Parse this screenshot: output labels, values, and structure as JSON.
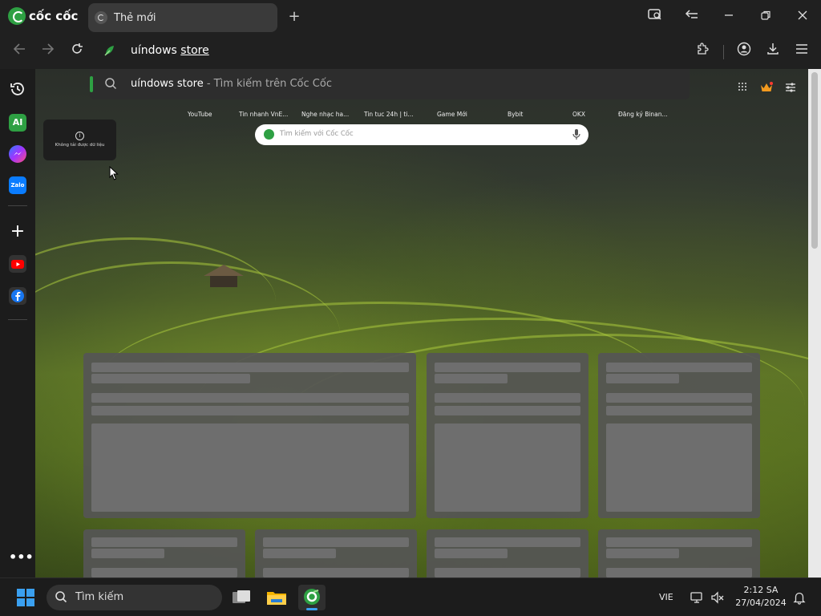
{
  "browser": {
    "brand": "cốc cốc",
    "tab_title": "Thẻ mới",
    "address_text_pre": "uíndows ",
    "address_text_underlined": "store"
  },
  "suggestion": {
    "query": "uíndows store",
    "suffix": " - Tìm kiếm trên Cốc Cốc"
  },
  "shortcuts": [
    "YouTube",
    "Tin nhanh VnE...",
    "Nghe nhạc ha...",
    "Tin tuc 24h | ti...",
    "Game Mới",
    "Bybit",
    "OKX",
    "Đăng ký Binan..."
  ],
  "search": {
    "placeholder": "Tìm kiếm với Cốc Cốc"
  },
  "tooltip": {
    "text": "Không tải được dữ liệu"
  },
  "sidebar": {
    "ai_label": "AI",
    "zalo_label": "Zalo"
  },
  "taskbar": {
    "search_label": "Tìm kiếm",
    "language": "VIE",
    "time": "2:12 SA",
    "date": "27/04/2024"
  },
  "colors": {
    "accent_green": "#2ea043",
    "windows_blue": "#3aa0f0"
  }
}
